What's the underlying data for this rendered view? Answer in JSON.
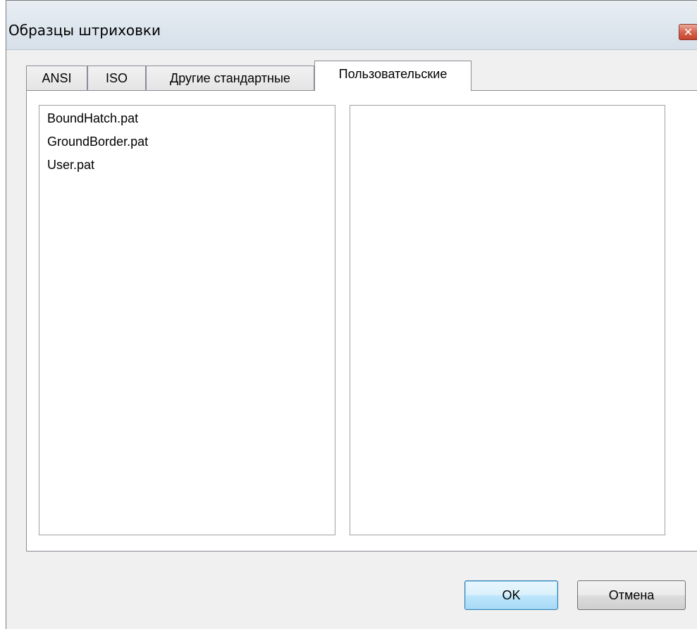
{
  "window": {
    "title": "Образцы штриховки",
    "close_glyph": "✕"
  },
  "tabs": [
    {
      "label": "ANSI",
      "active": false
    },
    {
      "label": "ISO",
      "active": false
    },
    {
      "label": "Другие стандартные",
      "active": false
    },
    {
      "label": "Пользовательские",
      "active": true
    }
  ],
  "file_list": {
    "items": [
      "BoundHatch.pat",
      "GroundBorder.pat",
      "User.pat"
    ]
  },
  "buttons": {
    "ok_label": "OK",
    "cancel_label": "Отмена"
  },
  "colors": {
    "window_bg": "#f0f0f0",
    "close_button": "#c4432b",
    "default_button_border": "#3c7fb1"
  }
}
